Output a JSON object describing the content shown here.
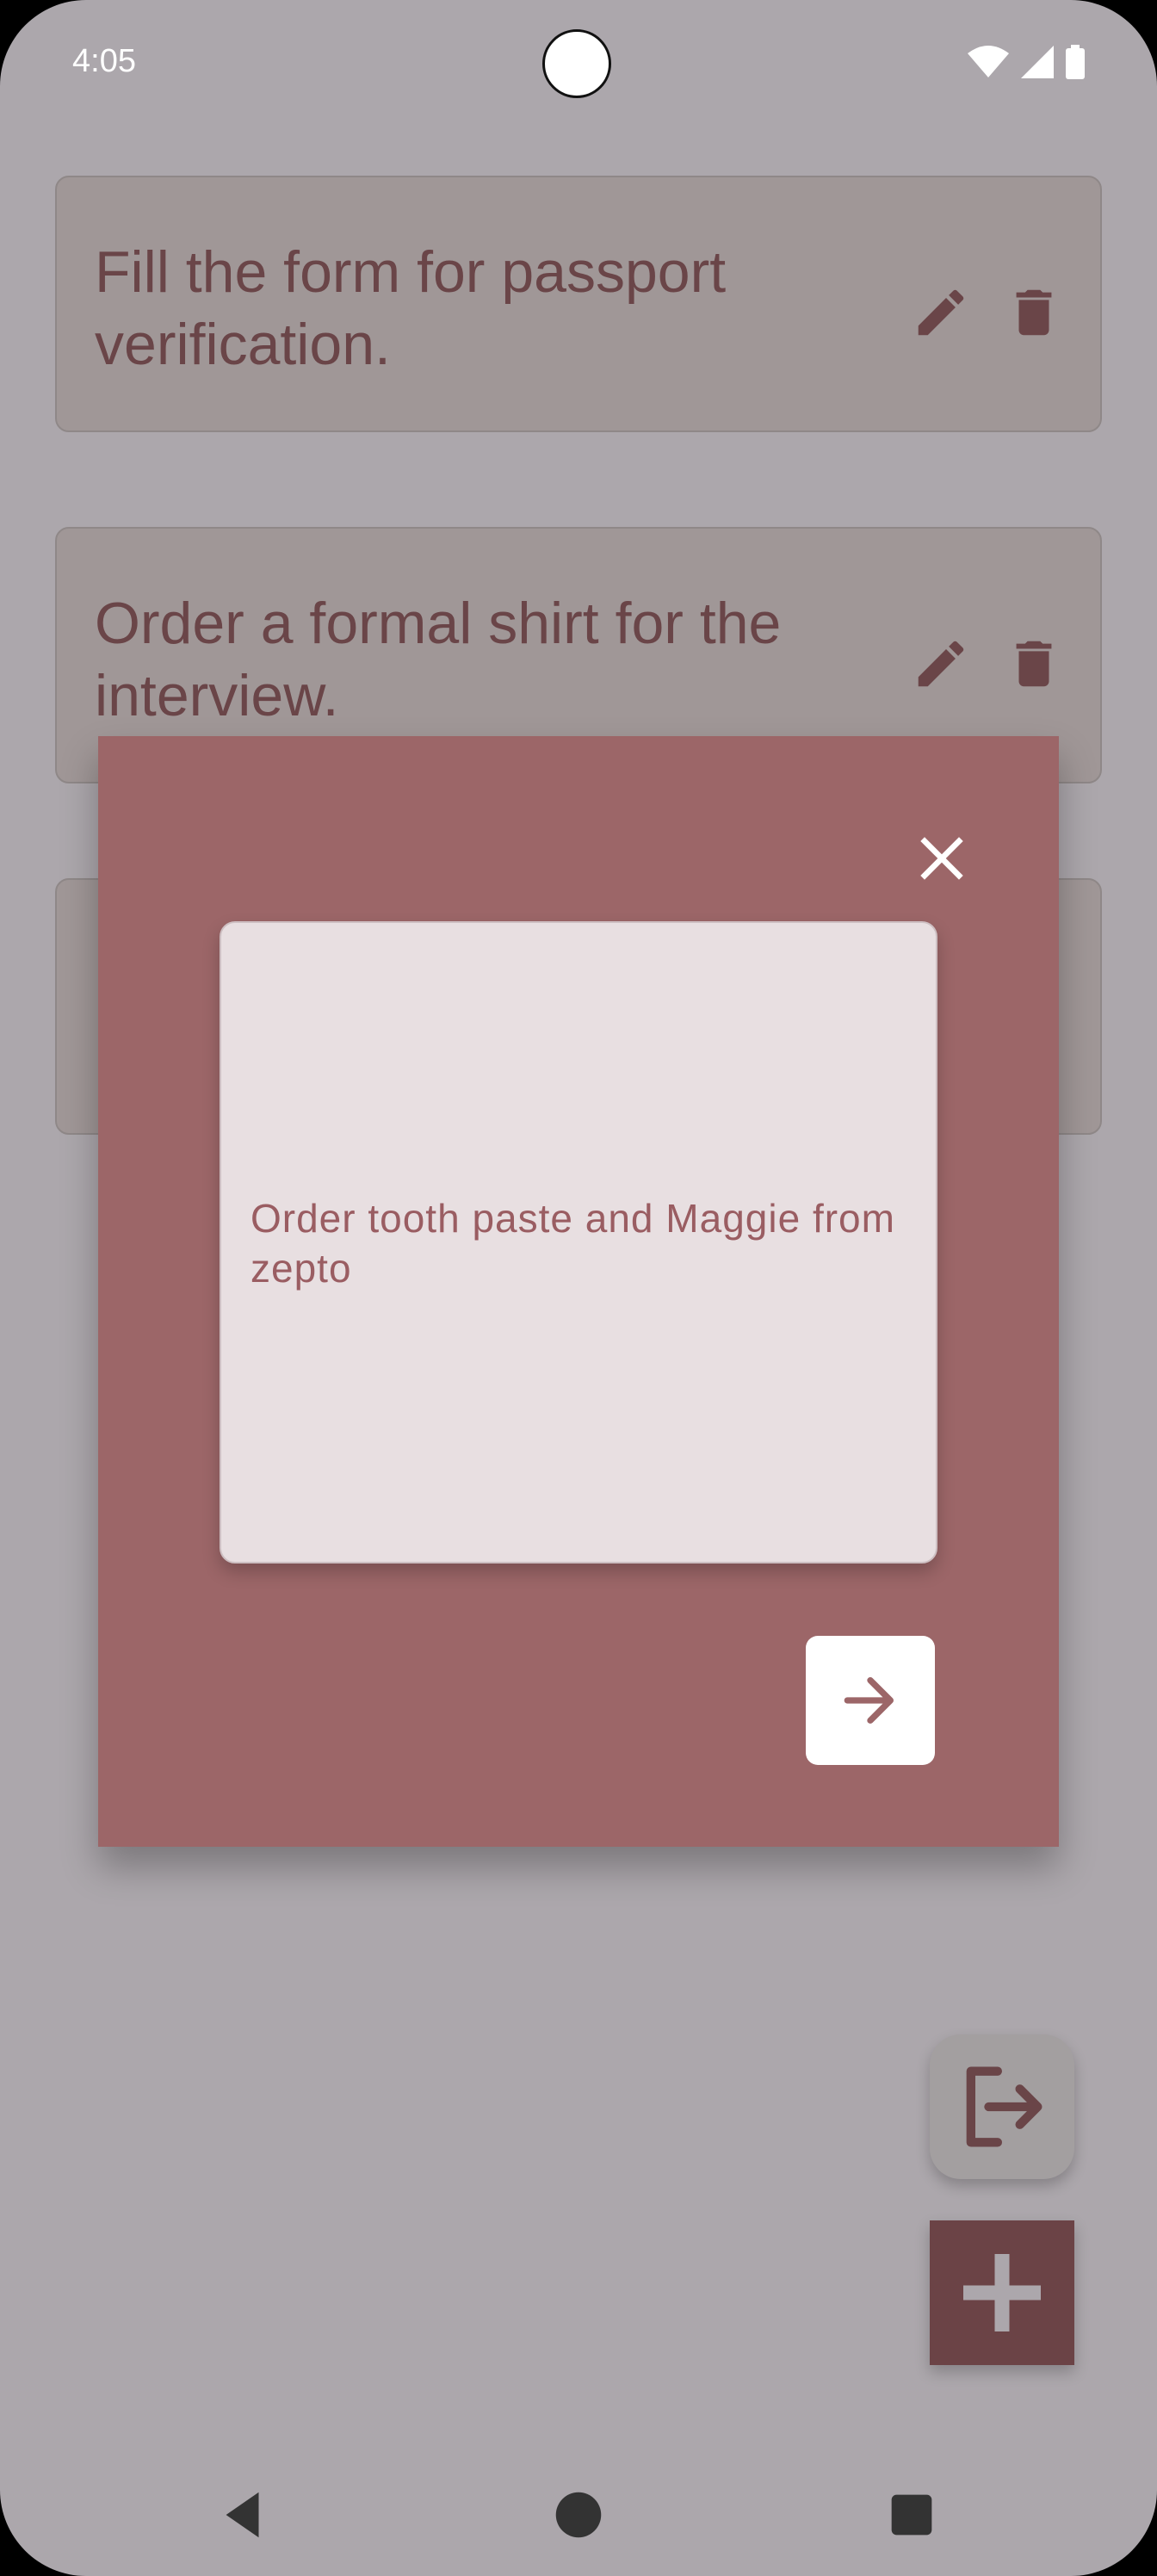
{
  "status_bar": {
    "time": "4:05",
    "icons": [
      "wifi-icon",
      "cellular-signal-icon",
      "battery-icon"
    ]
  },
  "tasks": [
    {
      "text": "Fill the form for passport verification.",
      "actions": [
        "edit-icon",
        "delete-icon"
      ]
    },
    {
      "text": "Order a formal shirt for the interview.",
      "actions": [
        "edit-icon",
        "delete-icon"
      ]
    },
    {
      "text": "",
      "actions": []
    }
  ],
  "dialog": {
    "close_icon": "close-icon",
    "note_text": "Order tooth paste and Maggie from zepto",
    "submit_icon": "arrow-forward-icon"
  },
  "fabs": {
    "logout_icon": "logout-icon",
    "add_icon": "add-icon"
  },
  "navigation": [
    "back-icon",
    "home-icon",
    "recents-icon"
  ],
  "colors": {
    "scrim": "#aca7ac",
    "dialog": "#9c6668",
    "card": "#a09797",
    "text_dark": "#6a4548",
    "note_bg": "#e8dfe1",
    "note_text": "#9a5d62",
    "fab_add": "#6b4346"
  }
}
